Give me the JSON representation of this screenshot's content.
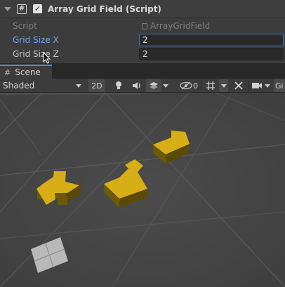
{
  "component": {
    "title": "Array Grid Field (Script)",
    "enabled": true,
    "properties": [
      {
        "label": "Script",
        "value": "ArrayGridField",
        "kind": "readonly"
      },
      {
        "label": "Grid Size X",
        "value": "2",
        "kind": "input",
        "focused": true
      },
      {
        "label": "Grid Size Z",
        "value": "2",
        "kind": "input",
        "focused": false
      }
    ]
  },
  "scene_tab": {
    "label": "Scene"
  },
  "toolbar": {
    "draw_mode": "Shaded",
    "mode_2d": "2D",
    "hidden_count": "0",
    "gizmos": "Gi"
  },
  "colors": {
    "accent_blue": "#6aa6f5",
    "piece_top": "#d9b01a",
    "piece_side": "#6e5a0a",
    "tile": "#bdbdbd"
  },
  "icons": [
    "script-icon",
    "checkbox-icon",
    "scene-hash-icon",
    "light-bulb-icon",
    "audio-icon",
    "effects-icon",
    "visibility-icon",
    "grid-icon",
    "tools-icon",
    "camera-icon"
  ]
}
